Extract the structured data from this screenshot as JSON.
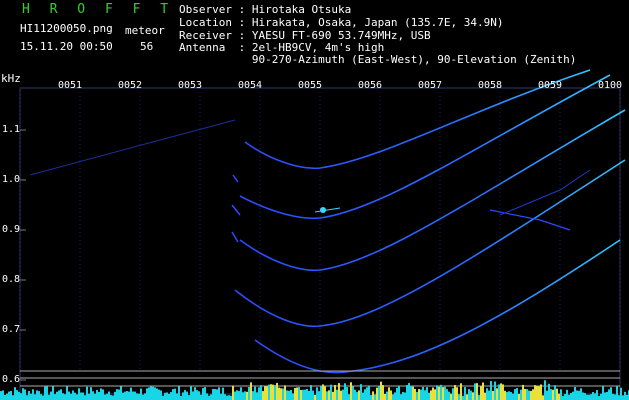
{
  "header": {
    "brand": "H R O F F T",
    "filename": "HI11200050.png",
    "meteor_label": "meteor",
    "timestamp": "15.11.20 00:50",
    "meteor_count": "56"
  },
  "info": {
    "observer": "Observer : Hirotaka Otsuka",
    "location": "Location : Hirakata, Osaka, Japan (135.7E, 34.9N)",
    "receiver": "Receiver : YAESU FT-690 53.749MHz, USB",
    "antenna": "Antenna  : 2el-HB9CV, 4m's high",
    "antenna2": "           90-270-Azimuth (East-West), 90-Elevation (Zenith)"
  },
  "axis": {
    "unit": "kHz",
    "y_ticks": [
      "1.1",
      "1.0",
      "0.9",
      "0.8",
      "0.7",
      "0.6"
    ],
    "x_ticks": [
      "0051",
      "0052",
      "0053",
      "0054",
      "0055",
      "0056",
      "0057",
      "0058",
      "0059",
      "0100"
    ]
  },
  "colors": {
    "brand": "#34d12a",
    "trace": "#2a4bff",
    "trace_bright": "#33c6ff",
    "grid": "#1a2a7a",
    "noise": "#19d6e6",
    "noise_yellow": "#e9e13a"
  }
}
